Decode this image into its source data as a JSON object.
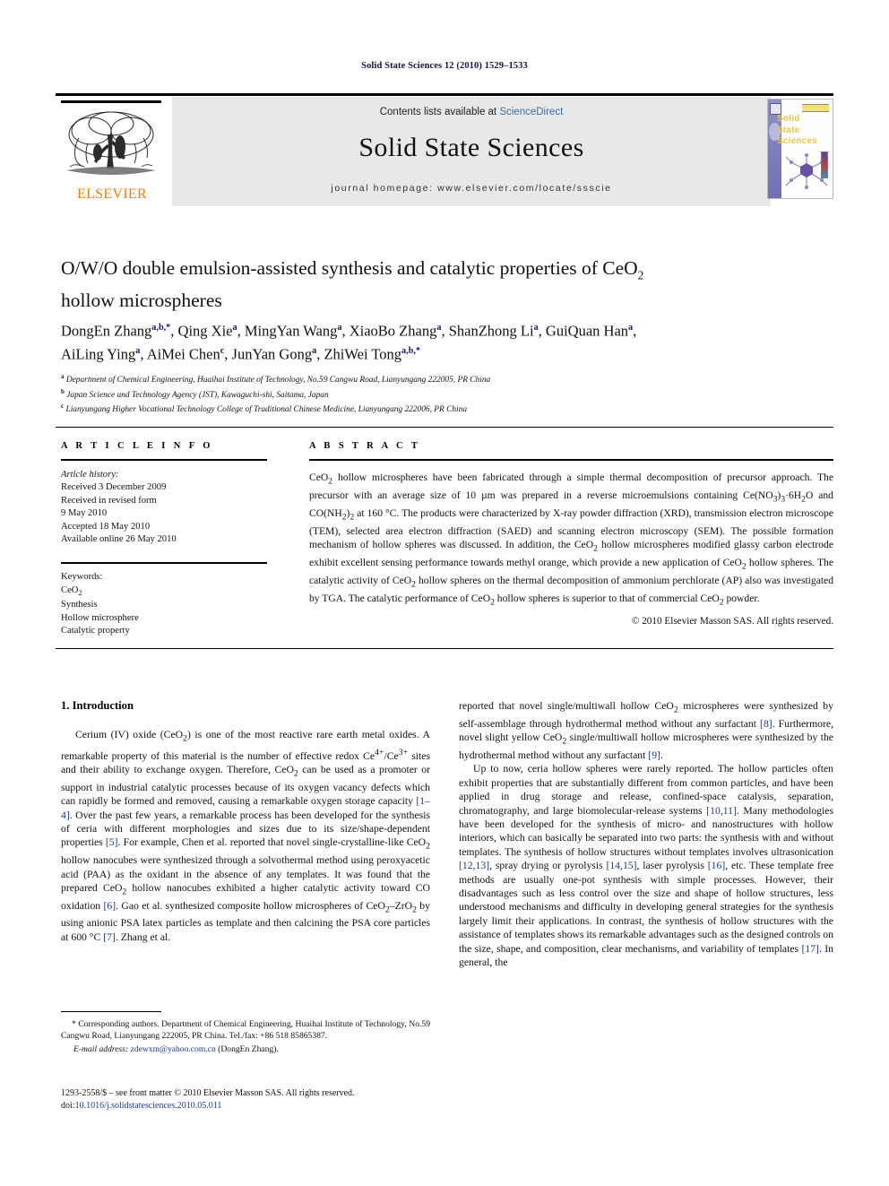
{
  "running_head": "Solid State Sciences 12 (2010) 1529–1533",
  "masthead": {
    "contents_prefix": "Contents lists available at ",
    "sciencedirect": "ScienceDirect",
    "journal_title": "Solid State Sciences",
    "homepage": "journal homepage: www.elsevier.com/locate/ssscie",
    "elsevier_wordmark": "ELSEVIER",
    "cover_title_lines": [
      "Solid",
      "State",
      "Sciences"
    ]
  },
  "article": {
    "title_line1_pre": "O/W/O double emulsion-assisted synthesis and catalytic properties of CeO",
    "title_sub": "2",
    "title_line2": "hollow microspheres",
    "authors_line1": "DongEn Zhang a,b,*, Qing Xie a, MingYan Wang a, XiaoBo Zhang a, ShanZhong Li a, GuiQuan Han a,",
    "authors_line2": "AiLing Ying a, AiMei Chen c, JunYan Gong a, ZhiWei Tong a,b,*",
    "affiliations": [
      "a Department of Chemical Engineering, Huaihai Institute of Technology, No.59 Cangwu Road, Lianyungang 222005, PR China",
      "b Japan Science and Technology Agency (JST), Kawaguchi-shi, Saitama, Japan",
      "c Lianyungang Higher Vocational Technology College of Traditional Chinese Medicine, Lianyungang 222006, PR China"
    ]
  },
  "article_info": {
    "heading": "A R T I C L E   I N F O",
    "history_label": "Article history:",
    "history_lines": [
      "Received 3 December 2009",
      "Received in revised form",
      "9 May 2010",
      "Accepted 18 May 2010",
      "Available online 26 May 2010"
    ],
    "keywords_label": "Keywords:",
    "keywords": [
      "CeO2",
      "Synthesis",
      "Hollow microsphere",
      "Catalytic property"
    ]
  },
  "abstract": {
    "heading": "A B S T R A C T",
    "text": "CeO2 hollow microspheres have been fabricated through a simple thermal decomposition of precursor approach. The precursor with an average size of 10 μm was prepared in a reverse microemulsions containing Ce(NO3)3·6H2O and CO(NH2)2 at 160 °C. The products were characterized by X-ray powder diffraction (XRD), transmission electron microscope (TEM), selected area electron diffraction (SAED) and scanning electron microscopy (SEM). The possible formation mechanism of hollow spheres was discussed. In addition, the CeO2 hollow microspheres modified glassy carbon electrode exhibit excellent sensing performance towards methyl orange, which provide a new application of CeO2 hollow spheres. The catalytic activity of CeO2 hollow spheres on the thermal decomposition of ammonium perchlorate (AP) also was investigated by TGA. The catalytic performance of CeO2 hollow spheres is superior to that of commercial CeO2 powder.",
    "copyright": "© 2010 Elsevier Masson SAS. All rights reserved."
  },
  "body": {
    "section_heading": "1. Introduction",
    "left_paragraph_1": "Cerium (IV) oxide (CeO2) is one of the most reactive rare earth metal oxides. A remarkable property of this material is the number of effective redox Ce4+/Ce3+ sites and their ability to exchange oxygen. Therefore, CeO2 can be used as a promoter or support in industrial catalytic processes because of its oxygen vacancy defects which can rapidly be formed and removed, causing a remarkable oxygen storage capacity [1–4]. Over the past few years, a remarkable process has been developed for the synthesis of ceria with different morphologies and sizes due to its size/shape-dependent properties [5]. For example, Chen et al. reported that novel single-crystalline-like CeO2 hollow nanocubes were synthesized through a solvothermal method using peroxyacetic acid (PAA) as the oxidant in the absence of any templates. It was found that the prepared CeO2 hollow nanocubes exhibited a higher catalytic activity toward CO oxidation [6]. Gao et al. synthesized composite hollow microspheres of CeO2–ZrO2 by using anionic PSA latex particles as template and then calcining the PSA core particles at 600 °C [7]. Zhang et al.",
    "right_paragraph_1": "reported that novel single/multiwall hollow CeO2 microspheres were synthesized by self-assemblage through hydrothermal method without any surfactant [8]. Furthermore, novel slight yellow CeO2 single/multiwall hollow microspheres were synthesized by the hydrothermal method without any surfactant [9].",
    "right_paragraph_2": "Up to now, ceria hollow spheres were rarely reported. The hollow particles often exhibit properties that are substantially different from common particles, and have been applied in drug storage and release, confined-space catalysis, separation, chromatography, and large biomolecular-release systems [10,11]. Many methodologies have been developed for the synthesis of micro- and nanostructures with hollow interiors, which can basically be separated into two parts: the synthesis with and without templates. The synthesis of hollow structures without templates involves ultrasonication [12,13], spray drying or pyrolysis [14,15], laser pyrolysis [16], etc. These template free methods are usually one-pot synthesis with simple processes. However, their disadvantages such as less control over the size and shape of hollow structures, less understood mechanisms and difficulty in developing general strategies for the synthesis largely limit their applications. In contrast, the synthesis of hollow structures with the assistance of templates shows its remarkable advantages such as the designed controls on the size, shape, and composition, clear mechanisms, and variability of templates [17]. In general, the"
  },
  "footnote": {
    "corresponding": "* Corresponding authors. Department of Chemical Engineering, Huaihai Institute of Technology, No.59 Cangwu Road, Lianyungang 222005, PR China. Tel./fax: +86 518 85865387.",
    "email_label": "E-mail address:",
    "email": "zdewxm@yahoo.com.cn",
    "email_owner": "(DongEn Zhang)."
  },
  "colophon": {
    "issn_line": "1293-2558/$ – see front matter © 2010 Elsevier Masson SAS. All rights reserved.",
    "doi_label": "doi:",
    "doi": "10.1016/j.solidstatesciences.2010.05.011"
  },
  "colors": {
    "link": "#3a6ea5",
    "reference": "#1a3a8f",
    "elsevier_orange": "#f08000",
    "running_head": "#14134a"
  }
}
